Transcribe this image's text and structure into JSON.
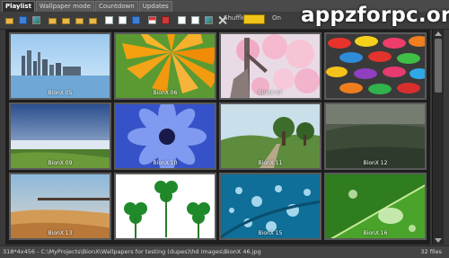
{
  "tabs": [
    "Playlist",
    "Wallpaper mode",
    "Countdown",
    "Updates"
  ],
  "toolbar": {
    "icons": [
      "folder-open-icon",
      "save-icon",
      "image-icon",
      "folder-icon",
      "folder-icon",
      "folder-icon",
      "folder-icon",
      "document-icon",
      "document-icon",
      "refresh-icon",
      "flag-icon",
      "error-icon",
      "document-icon",
      "document-icon",
      "image-icon",
      "tools-icon"
    ],
    "shuffle_label": "Shuffle",
    "on_label": "On",
    "shuffle_on": true
  },
  "thumbnails": [
    {
      "caption": "BionX 05"
    },
    {
      "caption": "BionX 06"
    },
    {
      "caption": "BionX 07"
    },
    {
      "caption": ""
    },
    {
      "caption": "BionX 09"
    },
    {
      "caption": "BionX 10"
    },
    {
      "caption": "BionX 11"
    },
    {
      "caption": "BionX 12"
    },
    {
      "caption": "BionX 13"
    },
    {
      "caption": ""
    },
    {
      "caption": "BionX 15"
    },
    {
      "caption": "BionX 16"
    }
  ],
  "status": {
    "left": "318*4x456 - C:\\MyProjects\\BionX\\Wallpapers for testing (dupes)\\hd images\\BionX 46.jpg",
    "right": "32 files"
  },
  "watermark": "appzforpc.org",
  "colors": {
    "accent": "#f2c31a",
    "background": "#3a3a3a"
  }
}
